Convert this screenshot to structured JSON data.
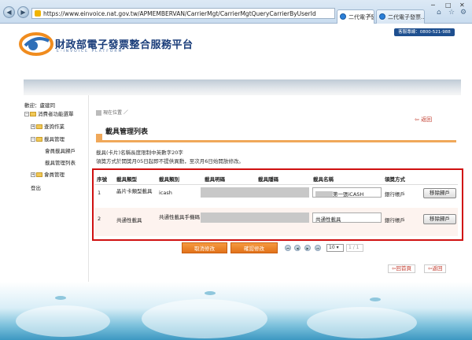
{
  "browser": {
    "url": "https://www.einvoice.nat.gov.tw/APMEMBERVAN/CarrierMgt/CarrierMgtQueryCarrierByUserId",
    "tabs": [
      {
        "label": "二代電子發..."
      },
      {
        "label": "二代電子發票..."
      }
    ]
  },
  "header": {
    "site_title": "財政部電子發票整合服務平台",
    "site_subtitle": "E-INVOICE PLATFORM",
    "hotline": "客服專線：0800-521-988"
  },
  "sidebar": {
    "welcome": "歡迎：盧建同",
    "items": [
      {
        "label": "消費者功能選單"
      },
      {
        "label": "查詢作業"
      },
      {
        "label": "載具管理"
      },
      {
        "label": "會員載具歸戶"
      },
      {
        "label": "載具管理列表"
      },
      {
        "label": "會員管理"
      },
      {
        "label": "登出"
      }
    ]
  },
  "main": {
    "breadcrumb": "現在位置 ／",
    "back_label": "返回",
    "page_title": "載具管理列表",
    "notes": [
      "載具(卡片)名稱長度限制中英數字20字",
      "領獎方式於開獎月05日起即不提供異動，至次月6日始開放修改。"
    ]
  },
  "table": {
    "headers": [
      "序號",
      "載具類型",
      "載具類別",
      "載具明碼",
      "載具隱碼",
      "載具名稱",
      "領獎方式"
    ],
    "rows": [
      {
        "seq": "1",
        "type": "晶片卡類型載具",
        "category": "icash",
        "name": "第一張iCASH",
        "prize": "銀行帳戶",
        "action": "移除歸戶"
      },
      {
        "seq": "2",
        "type": "共通性載具",
        "category": "共通性載具手機碼",
        "name": "共通性載具",
        "prize": "銀行帳戶",
        "action": "移除歸戶"
      }
    ]
  },
  "actions": {
    "cancel": "取消修改",
    "confirm": "確認修改",
    "page_size": "10",
    "page_indicator": "1 / 1",
    "home": "回首頁",
    "back": "返回"
  }
}
